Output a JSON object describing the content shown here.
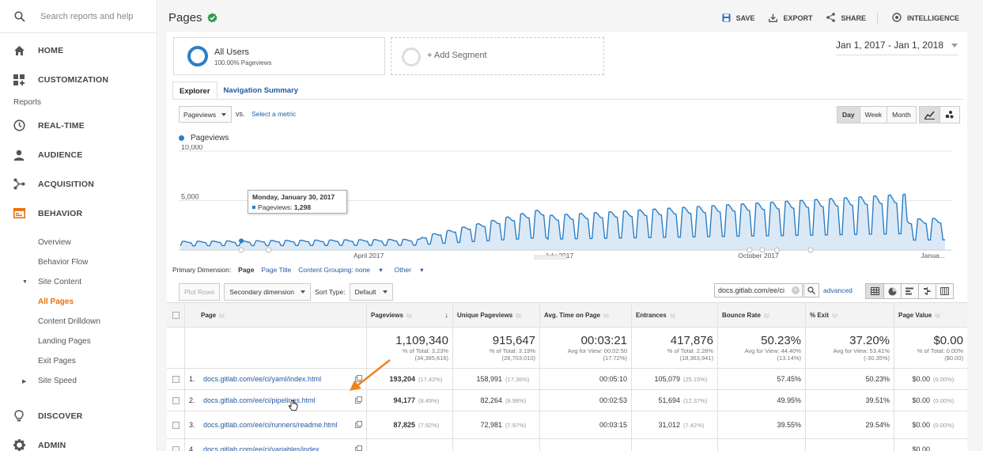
{
  "sidebar": {
    "search_placeholder": "Search reports and help",
    "nav_top": [
      {
        "label": "HOME",
        "icon": "home-icon"
      },
      {
        "label": "CUSTOMIZATION",
        "icon": "dashboard-icon"
      }
    ],
    "reports_label": "Reports",
    "nav_reports": [
      {
        "label": "REAL-TIME",
        "icon": "clock-icon"
      },
      {
        "label": "AUDIENCE",
        "icon": "person-icon"
      },
      {
        "label": "ACQUISITION",
        "icon": "acquisition-icon"
      },
      {
        "label": "BEHAVIOR",
        "icon": "behavior-icon"
      }
    ],
    "behavior_sub": [
      "Overview",
      "Behavior Flow"
    ],
    "site_content_label": "Site Content",
    "site_content_sub": [
      "All Pages",
      "Content Drilldown",
      "Landing Pages",
      "Exit Pages"
    ],
    "site_speed_label": "Site Speed",
    "nav_bottom": [
      {
        "label": "DISCOVER",
        "icon": "lightbulb-icon"
      },
      {
        "label": "ADMIN",
        "icon": "gear-icon"
      }
    ]
  },
  "header": {
    "title": "Pages",
    "actions": {
      "save": "SAVE",
      "export": "EXPORT",
      "share": "SHARE",
      "intelligence": "INTELLIGENCE"
    }
  },
  "segments": {
    "primary_title": "All Users",
    "primary_sub": "100.00% Pageviews",
    "add_segment": "+ Add Segment"
  },
  "date_range": "Jan 1, 2017 - Jan 1, 2018",
  "tabs": [
    "Explorer",
    "Navigation Summary"
  ],
  "metric_controls": {
    "metric": "Pageviews",
    "vs": "vs.",
    "select_metric": "Select a metric",
    "periods": [
      "Day",
      "Week",
      "Month"
    ]
  },
  "chart_data": {
    "type": "line",
    "series": [
      {
        "name": "Pageviews"
      }
    ],
    "y_ticks": [
      "10,000",
      "5,000"
    ],
    "ylim": [
      0,
      10000
    ],
    "x_ticks": [
      "April 2017",
      "July 2017",
      "October 2017",
      "Janua..."
    ],
    "tooltip": {
      "date": "Monday, January 30, 2017",
      "label": "Pageviews:",
      "value": "1,298"
    }
  },
  "dimension": {
    "label": "Primary Dimension:",
    "current": "Page",
    "others": [
      "Page Title",
      "Content Grouping: none",
      "Other"
    ]
  },
  "table_controls": {
    "plot_rows": "Plot Rows",
    "secondary_dimension": "Secondary dimension",
    "sort_type_label": "Sort Type:",
    "sort_type": "Default",
    "search_value": "docs.gitlab.com/ee/ci",
    "advanced": "advanced"
  },
  "table": {
    "columns": [
      "Page",
      "Pageviews",
      "Unique Pageviews",
      "Avg. Time on Page",
      "Entrances",
      "Bounce Rate",
      "% Exit",
      "Page Value"
    ],
    "totals": [
      {
        "big": "1,109,340",
        "l1": "% of Total: 3.23%",
        "l2": "(34,385,616)"
      },
      {
        "big": "915,647",
        "l1": "% of Total: 3.19%",
        "l2": "(28,703,010)"
      },
      {
        "big": "00:03:21",
        "l1": "Avg for View: 00:02:50",
        "l2": "(17.72%)"
      },
      {
        "big": "417,876",
        "l1": "% of Total: 2.28%",
        "l2": "(18,363,941)"
      },
      {
        "big": "50.23%",
        "l1": "Avg for View: 44.40%",
        "l2": "(13.14%)"
      },
      {
        "big": "37.20%",
        "l1": "Avg for View: 53.41%",
        "l2": "(-30.35%)"
      },
      {
        "big": "$0.00",
        "l1": "% of Total: 0.00%",
        "l2": "($0.00)"
      }
    ],
    "rows": [
      {
        "num": "1.",
        "page": "docs.gitlab.com/ee/ci/yaml/index.html",
        "pv": "193,204",
        "pv_pct": "(17.42%)",
        "upv": "158,991",
        "upv_pct": "(17.36%)",
        "time": "00:05:10",
        "ent": "105,079",
        "ent_pct": "(25.15%)",
        "bounce": "57.45%",
        "exit": "50.23%",
        "value": "$0.00",
        "value_pct": "(0.00%)"
      },
      {
        "num": "2.",
        "page": "docs.gitlab.com/ee/ci/pipelines.html",
        "pv": "94,177",
        "pv_pct": "(8.49%)",
        "upv": "82,264",
        "upv_pct": "(8.98%)",
        "time": "00:02:53",
        "ent": "51,694",
        "ent_pct": "(12.37%)",
        "bounce": "49.95%",
        "exit": "39.51%",
        "value": "$0.00",
        "value_pct": "(0.00%)"
      },
      {
        "num": "3.",
        "page": "docs.gitlab.com/ee/ci/runners/readme.html",
        "pv": "87,825",
        "pv_pct": "(7.92%)",
        "upv": "72,981",
        "upv_pct": "(7.97%)",
        "time": "00:03:15",
        "ent": "31,012",
        "ent_pct": "(7.42%)",
        "bounce": "39.55%",
        "exit": "29.54%",
        "value": "$0.00",
        "value_pct": "(0.00%)"
      },
      {
        "num": "4.",
        "page": "docs.gitlab.com/ee/ci/variables/index.",
        "pv": "",
        "pv_pct": "",
        "upv": "",
        "upv_pct": "",
        "time": "",
        "ent": "",
        "ent_pct": "",
        "bounce": "",
        "exit": "",
        "value": "$0.00",
        "value_pct": ""
      }
    ]
  },
  "colors": {
    "accent": "#e8710a",
    "link": "#2459a5",
    "chart": "#2b7fc6",
    "verified": "#2e9b47"
  }
}
